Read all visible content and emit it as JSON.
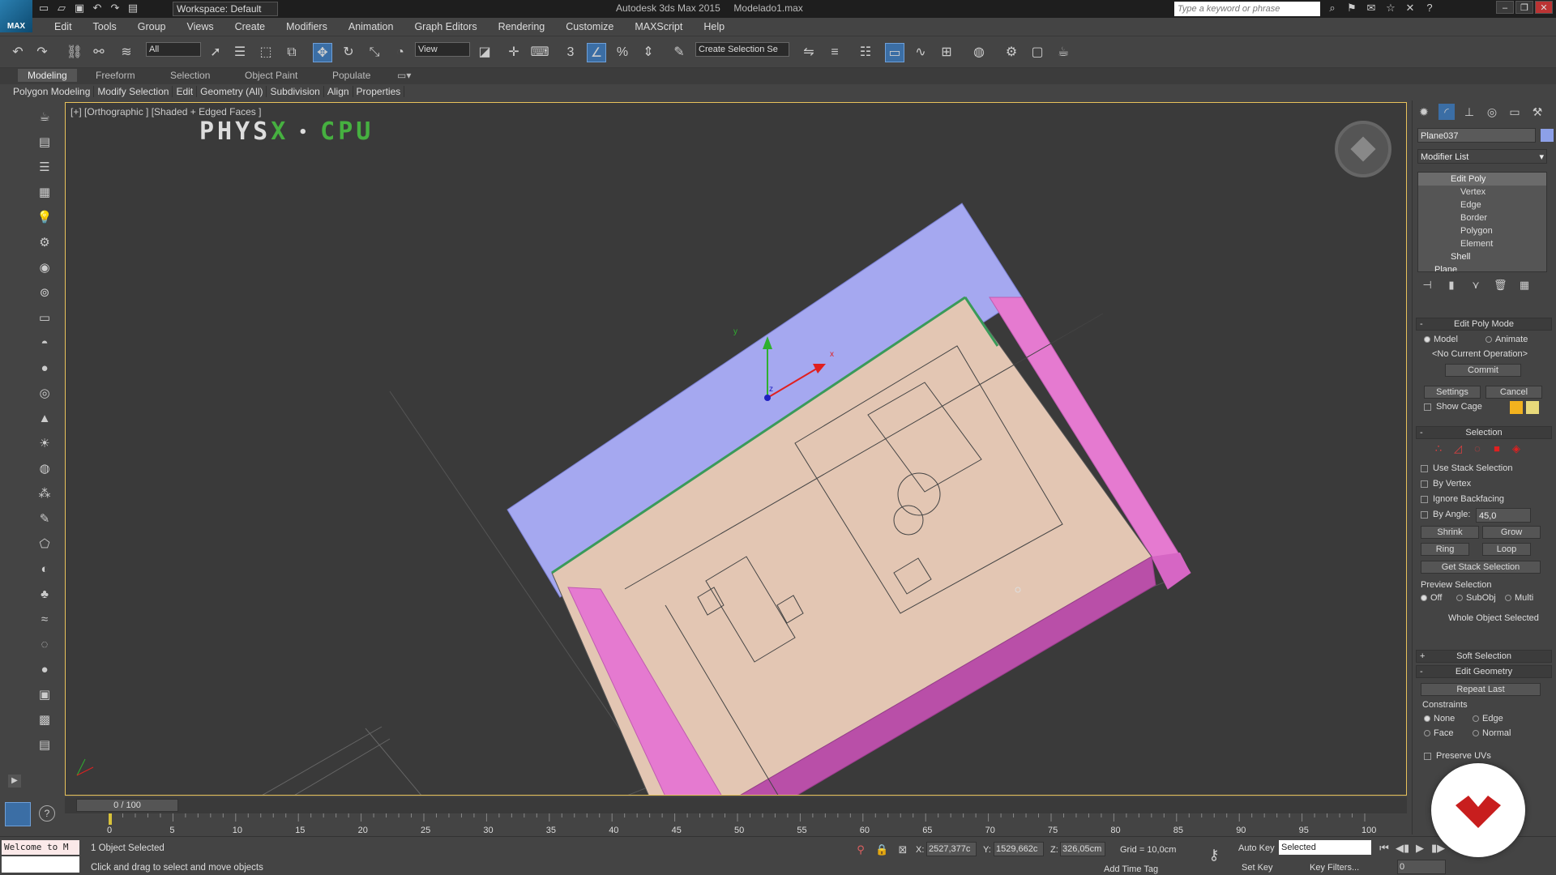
{
  "titlebar": {
    "workspace": "Workspace: Default",
    "app_name": "Autodesk 3ds Max 2015",
    "file_name": "Modelado1.max",
    "search_placeholder": "Type a keyword or phrase"
  },
  "menu": [
    "Edit",
    "Tools",
    "Group",
    "Views",
    "Create",
    "Modifiers",
    "Animation",
    "Graph Editors",
    "Rendering",
    "Customize",
    "MAXScript",
    "Help"
  ],
  "toolbar": {
    "selection_filter": "All",
    "ref_coord": "View",
    "named_selection": "Create Selection Se"
  },
  "ribbon": {
    "tabs": [
      "Modeling",
      "Freeform",
      "Selection",
      "Object Paint",
      "Populate"
    ],
    "active_tab": "Modeling",
    "panel_items": [
      "Polygon Modeling",
      "Modify Selection",
      "Edit",
      "Geometry (All)",
      "Subdivision",
      "Align",
      "Properties"
    ]
  },
  "viewport": {
    "label": "[+] [Orthographic ] [Shaded + Edged Faces ]",
    "physx_text": "PHYS",
    "physx_x": "X",
    "physx_sep": "•",
    "physx_cpu": "CPU",
    "axis_labels": {
      "x": "x",
      "y": "y",
      "z": "z"
    }
  },
  "command_panel": {
    "object_name": "Plane037",
    "object_color": "#8da0e8",
    "modifier_list": "Modifier List",
    "stack": [
      {
        "label": "Edit Poly",
        "level": "top"
      },
      {
        "label": "Vertex",
        "level": "sub"
      },
      {
        "label": "Edge",
        "level": "sub"
      },
      {
        "label": "Border",
        "level": "sub"
      },
      {
        "label": "Polygon",
        "level": "sub"
      },
      {
        "label": "Element",
        "level": "sub"
      },
      {
        "label": "Shell",
        "level": "mod"
      },
      {
        "label": "Plane",
        "level": "base"
      }
    ],
    "edit_poly_mode": {
      "title": "Edit Poly Mode",
      "model": "Model",
      "animate": "Animate",
      "current_op": "<No Current Operation>",
      "commit": "Commit",
      "settings": "Settings",
      "cancel": "Cancel",
      "show_cage": "Show Cage"
    },
    "selection": {
      "title": "Selection",
      "use_stack": "Use Stack Selection",
      "by_vertex": "By Vertex",
      "ignore_backfacing": "Ignore Backfacing",
      "by_angle": "By Angle:",
      "angle_value": "45,0",
      "shrink": "Shrink",
      "grow": "Grow",
      "ring": "Ring",
      "loop": "Loop",
      "get_stack": "Get Stack Selection",
      "preview": "Preview Selection",
      "off": "Off",
      "subobj": "SubObj",
      "multi": "Multi",
      "status": "Whole Object Selected"
    },
    "soft_selection": "Soft Selection",
    "edit_geometry": {
      "title": "Edit Geometry",
      "repeat_last": "Repeat Last",
      "constraints": "Constraints",
      "none": "None",
      "edge": "Edge",
      "face": "Face",
      "normal": "Normal",
      "preserve_uvs": "Preserve UVs"
    }
  },
  "timeline": {
    "slider": "0 / 100",
    "ticks": [
      0,
      5,
      10,
      15,
      20,
      25,
      30,
      35,
      40,
      45,
      50,
      55,
      60,
      65,
      70,
      75,
      80,
      85,
      90,
      95,
      100
    ]
  },
  "status": {
    "listener": "Welcome to M",
    "selection": "1 Object Selected",
    "prompt": "Click and drag to select and move objects",
    "x_label": "X:",
    "x_value": "2527,377c",
    "y_label": "Y:",
    "y_value": "1529,662c",
    "z_label": "Z:",
    "z_value": "326,05cm",
    "grid": "Grid = 10,0cm",
    "auto_key": "Auto Key",
    "set_key": "Set Key",
    "selected": "Selected",
    "key_filters": "Key Filters...",
    "add_time_tag": "Add Time Tag",
    "frame": "0"
  }
}
